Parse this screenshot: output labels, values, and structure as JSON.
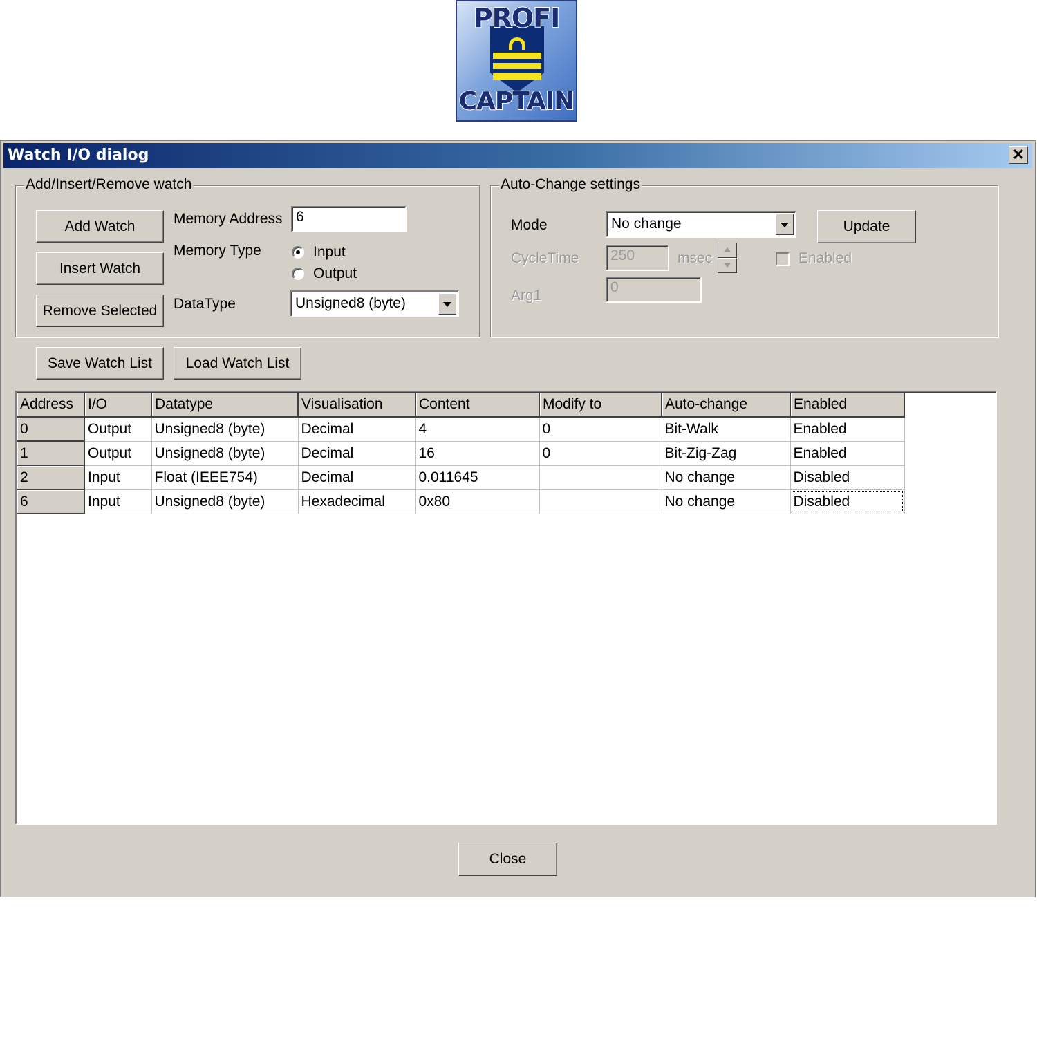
{
  "logo": {
    "line1": "PROFI",
    "line2": "CAPTAIN"
  },
  "dialog": {
    "title": "Watch I/O dialog",
    "close_glyph": "✕"
  },
  "watch_group": {
    "legend": "Add/Insert/Remove watch",
    "add_watch": "Add Watch",
    "insert_watch": "Insert Watch",
    "remove_selected": "Remove Selected",
    "memory_address_label": "Memory Address",
    "memory_address_value": "6",
    "memory_type_label": "Memory Type",
    "memory_type_options": [
      "Input",
      "Output"
    ],
    "memory_type_selected": "Input",
    "datatype_label": "DataType",
    "datatype_value": "Unsigned8 (byte)"
  },
  "auto_group": {
    "legend": "Auto-Change settings",
    "mode_label": "Mode",
    "mode_value": "No change",
    "update": "Update",
    "cycletime_label": "CycleTime",
    "cycletime_value": "250",
    "cycletime_unit": "msec",
    "enabled_label": "Enabled",
    "enabled_checked": false,
    "arg1_label": "Arg1",
    "arg1_value": "0"
  },
  "list_buttons": {
    "save": "Save Watch List",
    "load": "Load Watch List"
  },
  "grid": {
    "columns": [
      "Address",
      "I/O",
      "Datatype",
      "Visualisation",
      "Content",
      "Modify to",
      "Auto-change",
      "Enabled"
    ],
    "rows": [
      [
        "0",
        "Output",
        "Unsigned8 (byte)",
        "Decimal",
        "4",
        "0",
        "Bit-Walk",
        "Enabled"
      ],
      [
        "1",
        "Output",
        "Unsigned8 (byte)",
        "Decimal",
        "16",
        "0",
        "Bit-Zig-Zag",
        "Enabled"
      ],
      [
        "2",
        "Input",
        "Float (IEEE754)",
        "Decimal",
        "0.011645",
        "",
        "No change",
        "Disabled"
      ],
      [
        "6",
        "Input",
        "Unsigned8 (byte)",
        "Hexadecimal",
        "0x80",
        "",
        "No change",
        "Disabled"
      ]
    ]
  },
  "footer": {
    "close": "Close"
  }
}
